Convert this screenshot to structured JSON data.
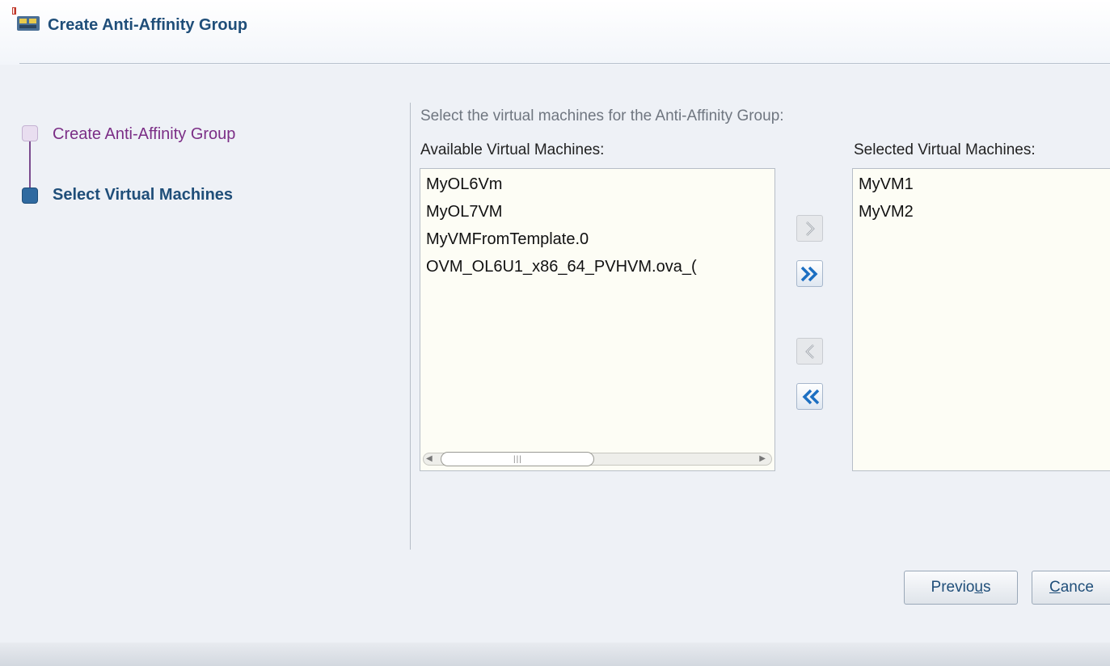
{
  "dialog": {
    "title": "Create Anti-Affinity Group"
  },
  "train": {
    "steps": [
      {
        "label": "Create Anti-Affinity Group",
        "state": "visited"
      },
      {
        "label": "Select Virtual Machines",
        "state": "current"
      }
    ]
  },
  "selection": {
    "instruction": "Select the virtual machines for the Anti-Affinity Group:",
    "available_label": "Available Virtual Machines:",
    "selected_label": "Selected Virtual Machines:",
    "available_items": [
      "MyOL6Vm",
      "MyOL7VM",
      "MyVMFromTemplate.0",
      "OVM_OL6U1_x86_64_PVHVM.ova_("
    ],
    "selected_items": [
      "MyVM1",
      "MyVM2"
    ]
  },
  "footer": {
    "previous": {
      "before": "Previo",
      "mnemonic": "u",
      "after": "s"
    },
    "cancel": {
      "mnemonic": "C",
      "after": "ance"
    }
  },
  "colors": {
    "accent": "#1f4e79",
    "visited_step": "#7b2e86",
    "background": "#eef1f6"
  }
}
